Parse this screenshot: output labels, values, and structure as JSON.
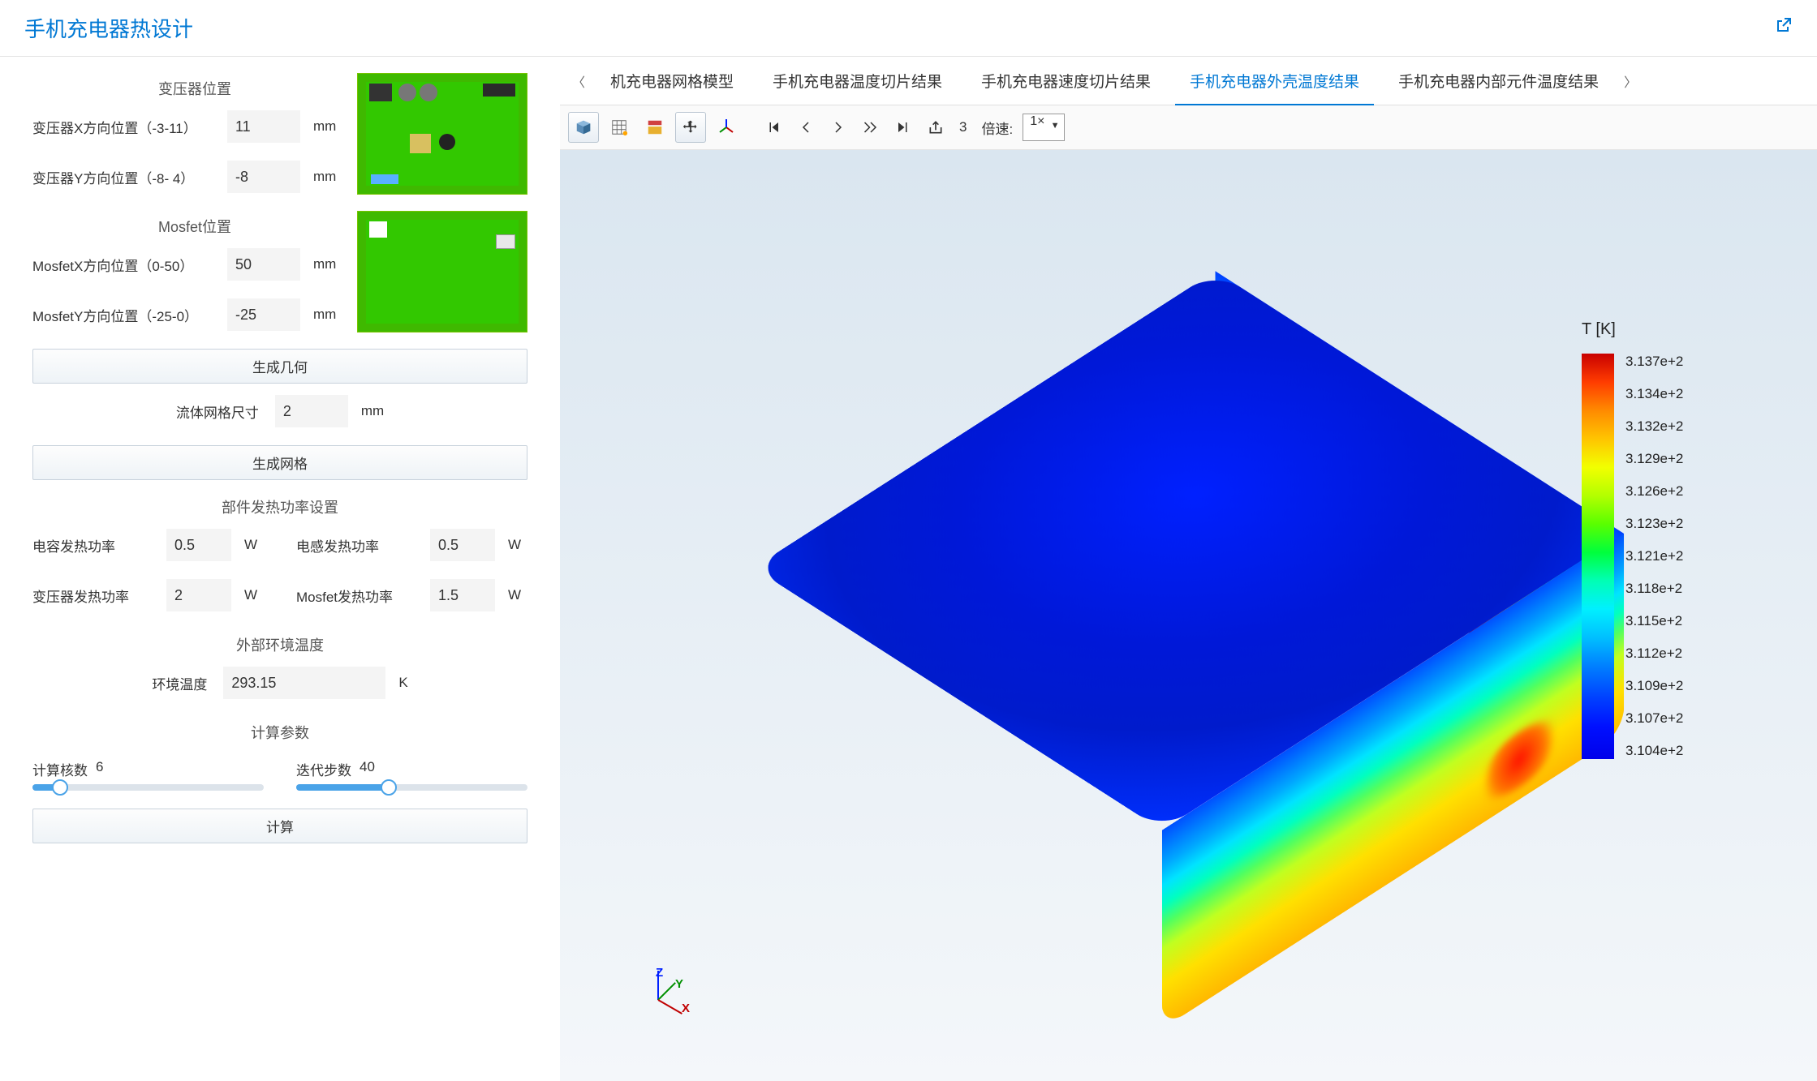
{
  "header": {
    "title": "手机充电器热设计"
  },
  "sidebar": {
    "transformer": {
      "heading": "变压器位置",
      "x": {
        "label": "变压器X方向位置（-3-11）",
        "value": "11",
        "unit": "mm"
      },
      "y": {
        "label": "变压器Y方向位置（-8- 4）",
        "value": "-8",
        "unit": "mm"
      }
    },
    "mosfet": {
      "heading": "Mosfet位置",
      "x": {
        "label": "MosfetX方向位置（0-50）",
        "value": "50",
        "unit": "mm"
      },
      "y": {
        "label": "MosfetY方向位置（-25-0）",
        "value": "-25",
        "unit": "mm"
      }
    },
    "btn_generate_geom": "生成几何",
    "mesh": {
      "label": "流体网格尺寸",
      "value": "2",
      "unit": "mm"
    },
    "btn_generate_mesh": "生成网格",
    "power": {
      "heading": "部件发热功率设置",
      "cap": {
        "label": "电容发热功率",
        "value": "0.5",
        "unit": "W"
      },
      "ind": {
        "label": "电感发热功率",
        "value": "0.5",
        "unit": "W"
      },
      "xfmr": {
        "label": "变压器发热功率",
        "value": "2",
        "unit": "W"
      },
      "mosfet": {
        "label": "Mosfet发热功率",
        "value": "1.5",
        "unit": "W"
      }
    },
    "ambient": {
      "heading": "外部环境温度",
      "label": "环境温度",
      "value": "293.15",
      "unit": "K"
    },
    "solve": {
      "heading": "计算参数",
      "cores": {
        "label": "计算核数",
        "value": "6"
      },
      "iters": {
        "label": "迭代步数",
        "value": "40"
      }
    },
    "btn_compute": "计算"
  },
  "tabs": {
    "items": [
      {
        "label": "机充电器网格模型",
        "active": false
      },
      {
        "label": "手机充电器温度切片结果",
        "active": false
      },
      {
        "label": "手机充电器速度切片结果",
        "active": false
      },
      {
        "label": "手机充电器外壳温度结果",
        "active": true
      },
      {
        "label": "手机充电器内部元件温度结果",
        "active": false
      }
    ]
  },
  "toolbar": {
    "frame": "3",
    "speed_label": "倍速:",
    "speed_value": "1×"
  },
  "legend": {
    "title": "T [K]",
    "values": [
      "3.137e+2",
      "3.134e+2",
      "3.132e+2",
      "3.129e+2",
      "3.126e+2",
      "3.123e+2",
      "3.121e+2",
      "3.118e+2",
      "3.115e+2",
      "3.112e+2",
      "3.109e+2",
      "3.107e+2",
      "3.104e+2"
    ]
  },
  "chart_data": {
    "type": "heatmap",
    "title": "T [K]",
    "color_scale_values": [
      313.7,
      313.4,
      313.2,
      312.9,
      312.6,
      312.3,
      312.1,
      311.8,
      311.5,
      311.2,
      310.9,
      310.7,
      310.4
    ],
    "range": [
      310.4,
      313.7
    ],
    "unit": "K"
  },
  "axes": {
    "x": "X",
    "y": "Y",
    "z": "Z"
  }
}
